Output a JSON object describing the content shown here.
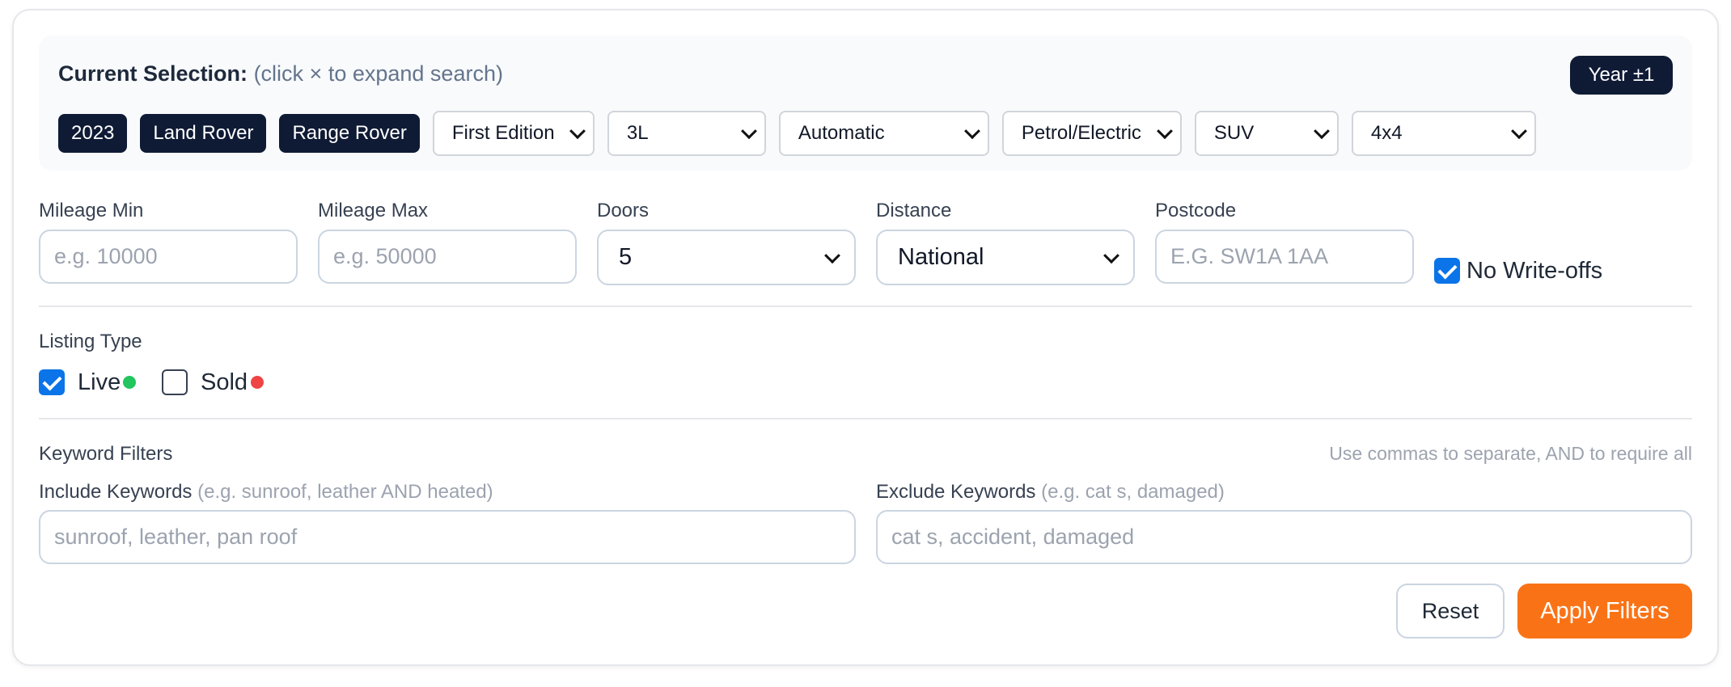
{
  "selection": {
    "title": "Current Selection:",
    "hint": "(click × to expand search)",
    "year_button": "Year ±1",
    "chips": [
      "2023",
      "Land Rover",
      "Range Rover"
    ],
    "selects": {
      "trim": "First Edition",
      "engine": "3L",
      "transmission": "Automatic",
      "fuel": "Petrol/Electric",
      "body": "SUV",
      "drive": "4x4"
    }
  },
  "fields": {
    "mileage_min": {
      "label": "Mileage Min",
      "placeholder": "e.g. 10000"
    },
    "mileage_max": {
      "label": "Mileage Max",
      "placeholder": "e.g. 50000"
    },
    "doors": {
      "label": "Doors",
      "value": "5"
    },
    "distance": {
      "label": "Distance",
      "value": "National"
    },
    "postcode": {
      "label": "Postcode",
      "placeholder": "E.G. SW1A 1AA"
    },
    "no_writeoffs": {
      "label": "No Write-offs",
      "checked": true
    }
  },
  "listing": {
    "title": "Listing Type",
    "live": {
      "label": "Live",
      "checked": true,
      "dot_color": "#22c55e"
    },
    "sold": {
      "label": "Sold",
      "checked": false,
      "dot_color": "#ef4444"
    }
  },
  "keywords": {
    "title": "Keyword Filters",
    "hint": "Use commas to separate, AND to require all",
    "include": {
      "label": "Include Keywords",
      "sub": "(e.g. sunroof, leather AND heated)",
      "placeholder": "sunroof, leather, pan roof"
    },
    "exclude": {
      "label": "Exclude Keywords",
      "sub": "(e.g. cat s, damaged)",
      "placeholder": "cat s, accident, damaged"
    }
  },
  "actions": {
    "reset": "Reset",
    "apply": "Apply Filters"
  }
}
